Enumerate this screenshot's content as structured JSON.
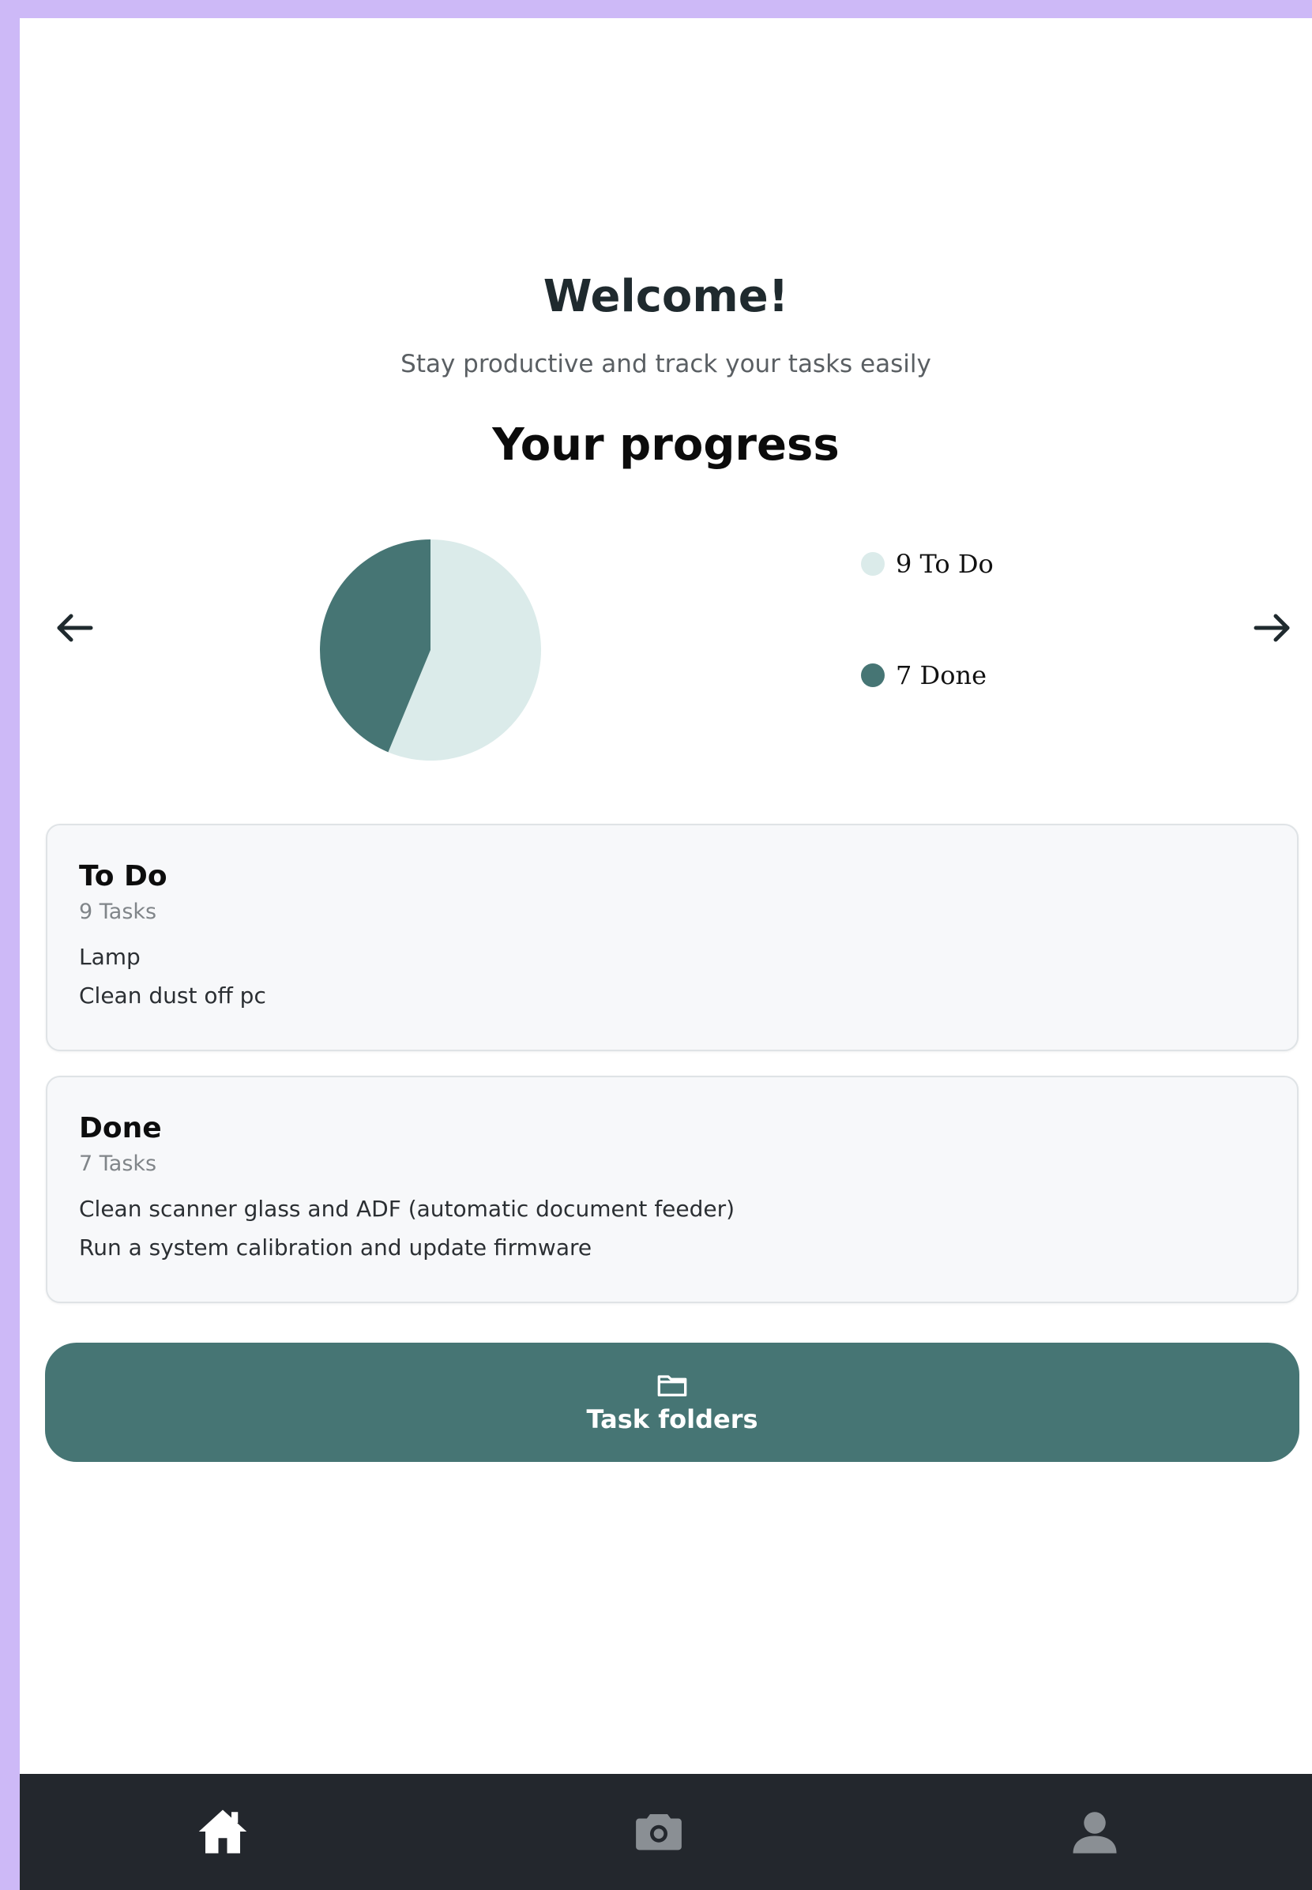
{
  "header": {
    "title": "Welcome!",
    "subtitle": "Stay productive and track your tasks easily"
  },
  "progress": {
    "title": "Your progress",
    "prev_icon": "arrow-left-icon",
    "next_icon": "arrow-right-icon"
  },
  "chart_data": {
    "type": "pie",
    "categories": [
      "To Do",
      "Done"
    ],
    "values": [
      9,
      7
    ],
    "colors": [
      "#dbebea",
      "#467574"
    ],
    "legend": [
      "9 To Do",
      "7 Done"
    ],
    "legend_placement": "right"
  },
  "cards": [
    {
      "title": "To Do",
      "count": "9 Tasks",
      "items": [
        "Lamp",
        "Clean dust off pc"
      ]
    },
    {
      "title": "Done",
      "count": "7 Tasks",
      "items": [
        "Clean scanner glass and ADF (automatic document feeder)",
        "Run a system calibration and update firmware"
      ]
    }
  ],
  "folders_button": {
    "label": "Task folders",
    "icon": "folder-icon"
  },
  "bottom_nav": {
    "items": [
      {
        "icon": "home-icon",
        "active": true
      },
      {
        "icon": "camera-icon",
        "active": false
      },
      {
        "icon": "user-icon",
        "active": false
      }
    ]
  },
  "colors": {
    "accent": "#467574",
    "accent_light": "#dbebea",
    "nav_bg": "#23272d",
    "frame": "#cdb9f7"
  }
}
